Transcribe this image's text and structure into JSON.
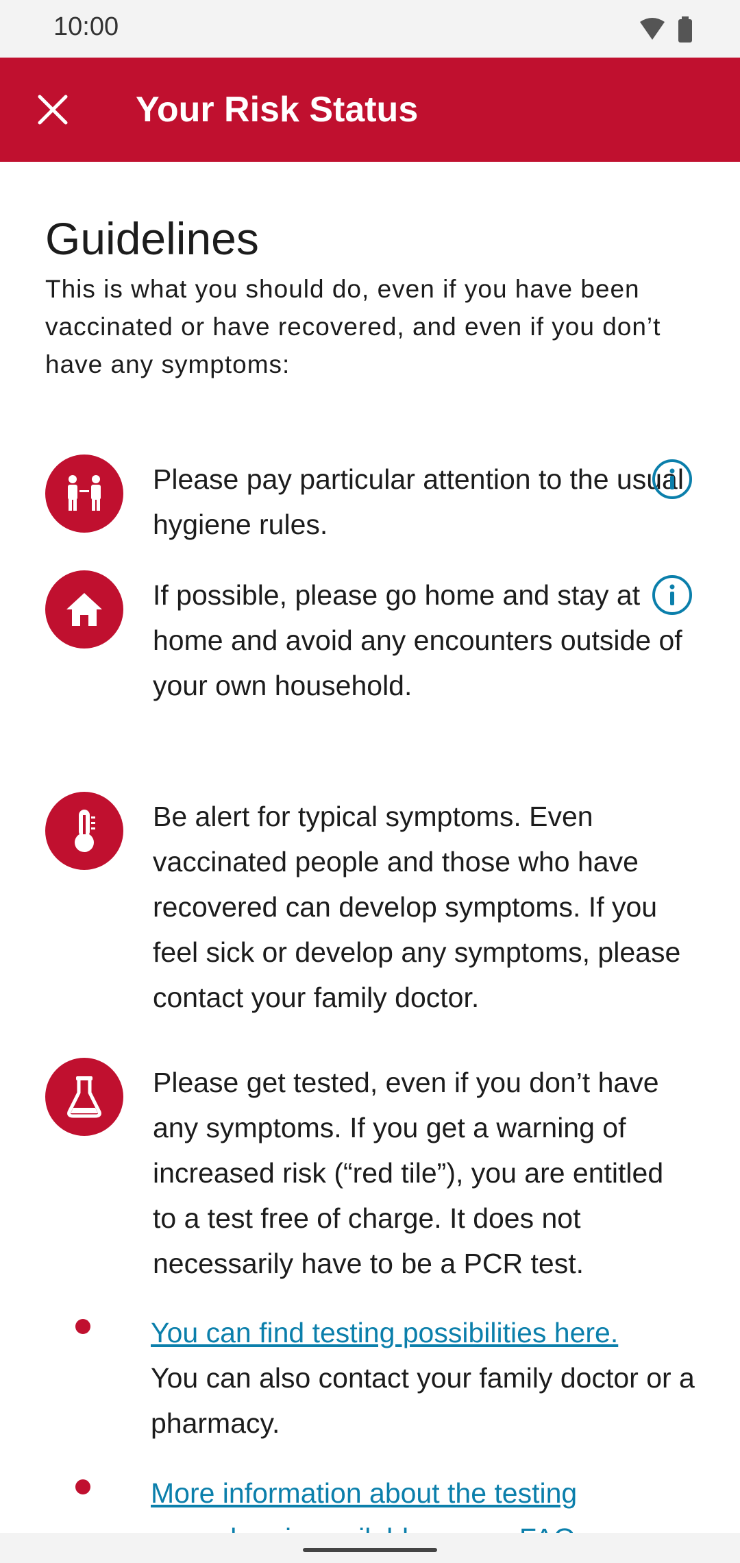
{
  "status_bar": {
    "time": "10:00",
    "wifi_icon": "wifi-icon",
    "battery_icon": "battery-icon"
  },
  "app_bar": {
    "title": "Your Risk Status",
    "close_icon": "close-icon"
  },
  "colors": {
    "brand": "#c0102f",
    "link": "#0b7fab",
    "text": "#1c1c1c"
  },
  "guidelines": {
    "heading": "Guidelines",
    "intro": "This is what you should do, even if you have been vaccinated or have recovered, and even if you don’t have any symptoms:",
    "items": [
      {
        "icon": "hygiene-people-icon",
        "text": "Please pay particular attention to the usual hygiene rules.",
        "has_info": true
      },
      {
        "icon": "home-icon",
        "text": "If possible, please go home and stay at home and avoid any encounters outside of your own household.",
        "has_info": true
      },
      {
        "icon": "thermometer-icon",
        "text": "Be alert for typical symptoms. Even vaccinated people and those who have recovered can develop symptoms. If you feel sick or develop any symptoms, please contact your family doctor.",
        "has_info": false
      },
      {
        "icon": "test-flask-icon",
        "text": "Please get tested, even if you don’t have any symptoms. If you get a warning of increased risk (“red tile”), you are entitled to a test free of charge. It does not necessarily have to be a PCR test.",
        "has_info": false
      }
    ],
    "bullets": [
      {
        "link": "You can find testing possibilities here.",
        "text": "You can also contact your family doctor or a pharmacy."
      },
      {
        "link": "More information about the testing procedure is available on our FAQ page."
      }
    ]
  }
}
